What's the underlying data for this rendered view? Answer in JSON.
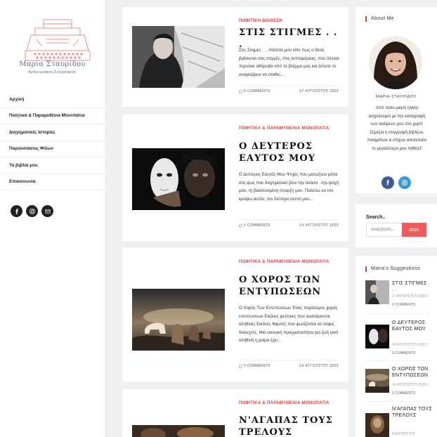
{
  "site": {
    "title": "Μαρία Σταυρίδου",
    "tagline": "Αρθρογράφος/Συγγραφέας"
  },
  "menu": [
    {
      "label": "Αρχική"
    },
    {
      "label": "Ποιητικά & Παραμυθένια Μονοπάτια"
    },
    {
      "label": "Διηγηματικές Ιστορίες"
    },
    {
      "label": "Παρουσιάσεις Φίλων"
    },
    {
      "label": "Τα βιβλία μου"
    },
    {
      "label": "Επικοινωνία"
    }
  ],
  "social_icons": [
    "facebook-icon",
    "instagram-icon",
    "email-icon"
  ],
  "posts": [
    {
      "category": "ΠΟΙΗΤΙΚΗ ΔΙΑΘΕΣΗ",
      "title": "ΣΤΙΣ ΣΤΙΓΜΕΣ . . .",
      "excerpt": "Στις Στιγμές . . . Κάποτε μου είπε πως ο Θεός βρίσκεται στις στιγμές, στις λεπτομέρειες, που άλλοτε περνάνε αθόρυβα από το βλέμμα μας και άλλοτε το αναγκάζουν να σταθεί...",
      "comments": "0 COMMENTS",
      "date": "17 ΑΥΓΟΥΣΤΟΥ 2023"
    },
    {
      "category": "ΠΟΙΗΤΙΚΑ & ΠΑΡΑΜΥΘΕΝΙΑ ΜΟΝΟΠΑΤΙΑ",
      "title": "Ο ΔΕΥΤΕΡΟΣ ΕΑΥΤΟΣ ΜΟΥ",
      "excerpt": "Ο Δεύτερος Εαυτός Μου Ψυχές που ματώζουν μέσα στο φως που διηγηματικά ζουν την ανάσα ..την ψυχή μου, τη βασανισμένη ύπαρξη μου. Παλεύω να τον κρύψω αυτόν, τον δεύτερο εαυτό μου...",
      "comments": "0 COMMENTS",
      "date": "14 ΑΥΓΟΥΣΤΟΥ 2023"
    },
    {
      "category": "ΠΟΙΗΤΙΚΑ & ΠΑΡΑΜΥΘΕΝΙΑ ΜΟΝΟΠΑΤΙΑ",
      "title": "Ο ΧΟΡΟΣ ΤΩΝ ΕΝΤΥΠΩΣΕΩΝ",
      "excerpt": "Ο Χορός Των Εντυπώσεων Ένας παράλογος χορός εντυπώσεων Εικόνες ψεύτικες που λανσάρονται αληθινές Εικόνες θαμπές που φωτίζονται σε νόφες διαλεχτές. Μια εικονική πραγματικότητα για ζωή γιατί αληθινή η μοίρα έχει...",
      "comments": "0 COMMENTS",
      "date": "14 ΑΥΓΟΥΣΤΟΥ 2023"
    },
    {
      "category": "ΠΟΙΗΤΙΚΑ & ΠΑΡΑΜΥΘΕΝΙΑ ΜΟΝΟΠΑΤΙΑ",
      "title": "Ν'ΑΓΑΠΑΣ ΤΟΥΣ ΤΡΕΛΟΥΣ"
    }
  ],
  "about": {
    "title": "About Me",
    "name": "ΜΑΡΙΑ ΣΤΑΥΡΙΔΟΥ",
    "text": "Από πολύ μικρή ηλικία ασχολούμαι με την καταγραφή των σκέψεών μου στο χαρτί. Σήμερα η συγγραφή βιβλίων, ποιημάτων & στίχων αποτελούν το μεγαλύτερο μου πάθος!!"
  },
  "search": {
    "label": "Search..",
    "placeholder": "αναζήτηση...",
    "button": "GO!"
  },
  "suggestions": {
    "title": "Maria's Suggestions",
    "items": [
      {
        "title": "ΣΤΙΣ ΣΤΙΓΜΕΣ . . .",
        "date": "17 ΑΥΓΟΥΣΤΟΥ 2023 /",
        "comments": "0 COMMENTS"
      },
      {
        "title": "Ο ΔΕΥΤΕΡΟΣ ΕΑΥΤΟΣ ΜΟΥ",
        "date": "14 ΑΥΓΟΥΣΤΟΥ 2023 /",
        "comments": "0 COMMENTS"
      },
      {
        "title": "Ο ΧΟΡΟΣ ΤΩΝ ΕΝΤΥΠΩΣΕΩΝ",
        "date": "14 ΑΥΓΟΥΣΤΟΥ 2023 /",
        "comments": "0 COMMENTS"
      },
      {
        "title": "Ν'ΑΓΑΠΑΣ ΤΟΥΣ ΤΡΕΛΟΥΣ",
        "date": "8 ΑΥΓΟΥΣΤΟΥ",
        "comments": ""
      }
    ]
  },
  "colors": {
    "accent": "#e03a3a",
    "logo": "#f08a8a",
    "facebook": "#3b5998",
    "instagram": "#3a9ad0"
  }
}
